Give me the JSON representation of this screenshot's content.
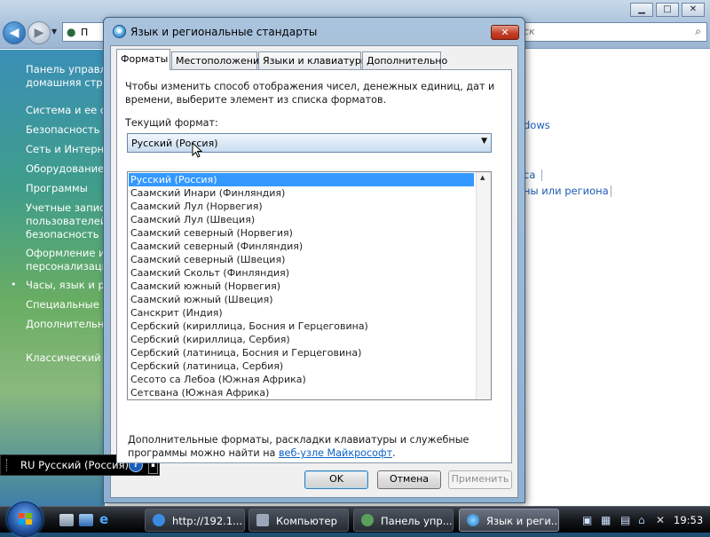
{
  "control_panel": {
    "address_partial": "П",
    "search_partial": "ск",
    "sidebar": [
      "Панель управле",
      "домашняя стра",
      "Система и ее об",
      "Безопасность",
      "Сеть и Интерне",
      "Оборудование и",
      "Программы",
      "Учетные записи",
      "пользователей",
      "безопасность",
      "Оформление и",
      "персонализаци",
      "Часы, язык и ре",
      "Специальные в",
      "Дополнительны",
      "Классический в"
    ],
    "main_links": [
      "dows",
      "са",
      "ны или региона"
    ]
  },
  "dialog": {
    "title": "Язык и региональные стандарты",
    "close_glyph": "✕",
    "tabs": [
      "Форматы",
      "Местоположение",
      "Языки и клавиатуры",
      "Дополнительно"
    ],
    "intro_line1": "Чтобы изменить способ отображения чисел, денежных единиц, дат и",
    "intro_line2": "времени, выберите элемент из списка форматов.",
    "current_format_label": "Текущий формат:",
    "current_format_value": "Русский (Россия)",
    "format_list": [
      "Русский (Россия)",
      "Саамский Инари (Финляндия)",
      "Саамский Лул (Норвегия)",
      "Саамский Лул (Швеция)",
      "Саамский северный (Норвегия)",
      "Саамский северный (Финляндия)",
      "Саамский северный (Швеция)",
      "Саамский Скольт (Финляндия)",
      "Саамский южный (Норвегия)",
      "Саамский южный (Швеция)",
      "Санскрит (Индия)",
      "Сербский (кириллица, Босния и Герцеговина)",
      "Сербский (кириллица, Сербия)",
      "Сербский (латиница, Босния и Герцеговина)",
      "Сербский (латиница, Сербия)",
      "Сесото са Лебоа (Южная Африка)",
      "Сетсвана (Южная Африка)"
    ],
    "footer_line1": "Дополнительные форматы, раскладки клавиатуры и служебные",
    "footer_line2_prefix": "программы можно найти на",
    "footer_link": "веб-узле Майкрософт",
    "footer_suffix": ".",
    "ok": "OK",
    "cancel": "Отмена",
    "apply": "Применить"
  },
  "language_bar": {
    "language": "RU Русский (Россия)",
    "help": "?"
  },
  "taskbar": {
    "buttons": [
      "http://192.1...",
      "Компьютер",
      "Панель упр...",
      "Язык и реги..."
    ],
    "clock": "19:53"
  },
  "colors": {
    "selection": "#3399ff",
    "link": "#0b61c9",
    "sidebar_top": "#3a8fb5"
  }
}
